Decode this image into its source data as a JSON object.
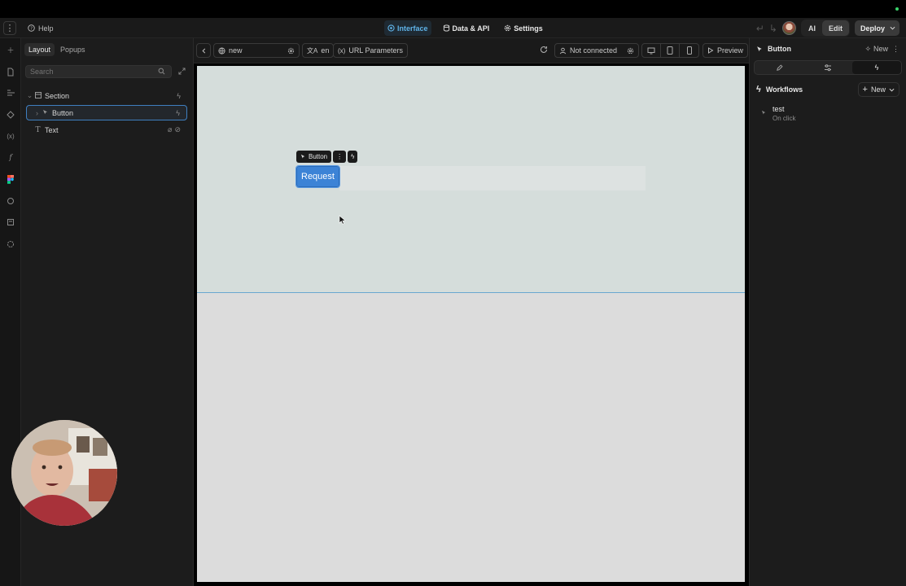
{
  "topbar": {
    "help": "Help",
    "tabs": [
      {
        "label": "Interface",
        "active": true
      },
      {
        "label": "Data & API",
        "active": false
      },
      {
        "label": "Settings",
        "active": false
      }
    ],
    "ai": "AI",
    "edit": "Edit",
    "deploy": "Deploy"
  },
  "left": {
    "tabs": [
      "Layout",
      "Popups"
    ],
    "search_placeholder": "Search",
    "tree": [
      {
        "label": "Section",
        "type": "section"
      },
      {
        "label": "Button",
        "type": "button",
        "selected": true
      },
      {
        "label": "Text",
        "type": "text"
      }
    ]
  },
  "toolbar": {
    "page": "new",
    "language": "en",
    "url_params": "URL Parameters",
    "connection": "Not connected",
    "preview": "Preview"
  },
  "canvas": {
    "floating_label": "Button",
    "button_text": "Request",
    "section_color": "#d5dddb",
    "accent": "#3c83d6"
  },
  "right": {
    "element": "Button",
    "new": "New",
    "workflows_title": "Workflows",
    "workflows_new": "New",
    "workflows": [
      {
        "name": "test",
        "trigger": "On click"
      }
    ]
  }
}
